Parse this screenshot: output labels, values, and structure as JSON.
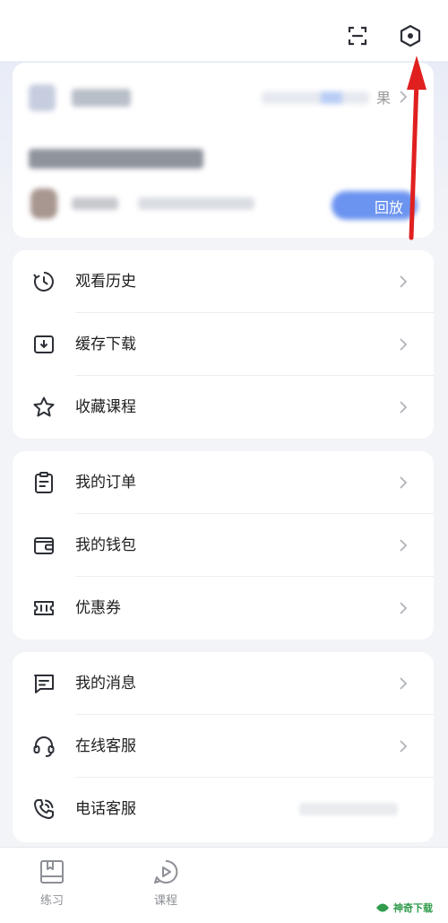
{
  "topbar": {
    "scan_icon": "scan-icon",
    "settings_icon": "hexagon-settings-icon"
  },
  "live_card": {
    "more_label": "果",
    "replay_label": "回放"
  },
  "menu_groups": [
    {
      "items": [
        {
          "label": "观看历史",
          "icon": "history-icon"
        },
        {
          "label": "缓存下载",
          "icon": "download-icon"
        },
        {
          "label": "收藏课程",
          "icon": "star-icon"
        }
      ]
    },
    {
      "items": [
        {
          "label": "我的订单",
          "icon": "clipboard-icon"
        },
        {
          "label": "我的钱包",
          "icon": "wallet-icon"
        },
        {
          "label": "优惠券",
          "icon": "coupon-icon"
        }
      ]
    },
    {
      "items": [
        {
          "label": "我的消息",
          "icon": "message-icon"
        },
        {
          "label": "在线客服",
          "icon": "headset-icon"
        },
        {
          "label": "电话客服",
          "icon": "phone-icon"
        }
      ]
    }
  ],
  "tabbar": {
    "tabs": [
      {
        "label": "练习",
        "icon": "practice-book-icon"
      },
      {
        "label": "课程",
        "icon": "course-play-icon"
      }
    ]
  },
  "watermark": {
    "text": "神奇下载"
  },
  "colors": {
    "accent_blue": "#6b93f0",
    "arrow_red": "#e0201f",
    "icon_dark": "#2c2f36",
    "watermark_green": "#2f9b4b"
  }
}
